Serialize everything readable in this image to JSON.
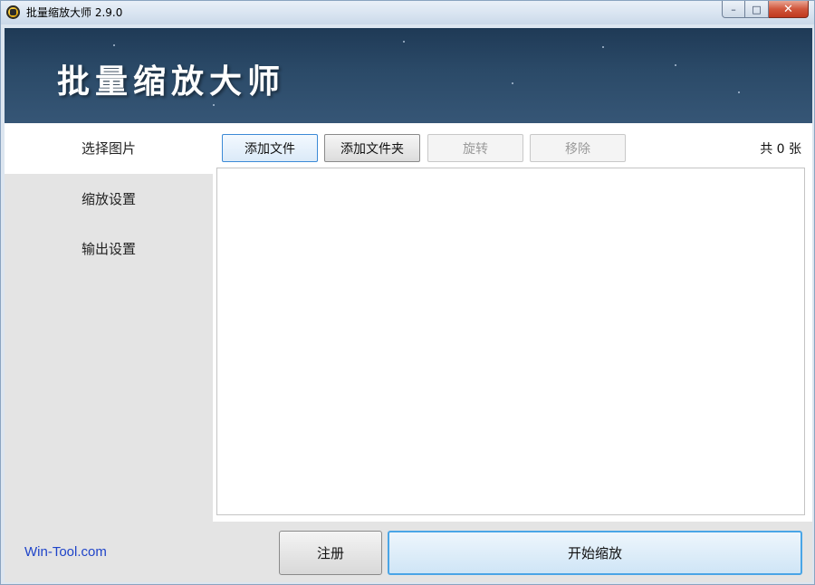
{
  "window": {
    "title": "批量缩放大师 2.9.0",
    "controls": {
      "minimize": "–",
      "maximize": "□",
      "close": "✕"
    }
  },
  "banner": {
    "title": "批量缩放大师"
  },
  "sidebar": {
    "items": [
      {
        "label": "选择图片",
        "active": true
      },
      {
        "label": "缩放设置",
        "active": false
      },
      {
        "label": "输出设置",
        "active": false
      }
    ]
  },
  "toolbar": {
    "add_file": "添加文件",
    "add_folder": "添加文件夹",
    "rotate": "旋转",
    "remove": "移除",
    "count": "共 0 张"
  },
  "footer": {
    "link": "Win-Tool.com",
    "register": "注册",
    "start": "开始缩放"
  },
  "colors": {
    "accent": "#3c8ad6",
    "link": "#1f44c9",
    "banner": "#2b4a68"
  }
}
